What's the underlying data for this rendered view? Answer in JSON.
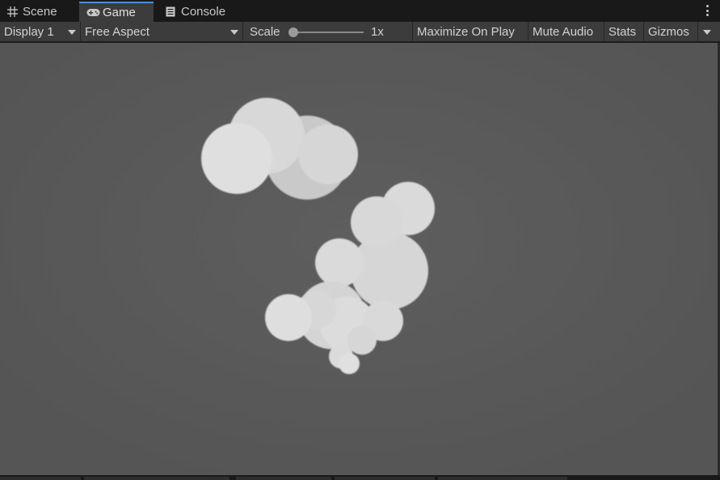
{
  "tabs": [
    {
      "label": "Scene",
      "icon": "grid-icon"
    },
    {
      "label": "Game",
      "icon": "gamepad-icon",
      "active": true
    },
    {
      "label": "Console",
      "icon": "console-icon"
    }
  ],
  "menu_icon": "kebab-menu-icon",
  "toolbar": {
    "display": "Display 1",
    "aspect": "Free Aspect",
    "scale_label": "Scale",
    "scale_value": "1x",
    "scale_slider_fraction": 0.0,
    "maximize": "Maximize On Play",
    "mute": "Mute Audio",
    "stats": "Stats",
    "gizmos": "Gizmos"
  },
  "colors": {
    "background": "#191919",
    "toolbar": "#3c3c3c",
    "viewport": "#595959",
    "tab_accent": "#4d8fd8",
    "particle": "#e0e0e0"
  }
}
